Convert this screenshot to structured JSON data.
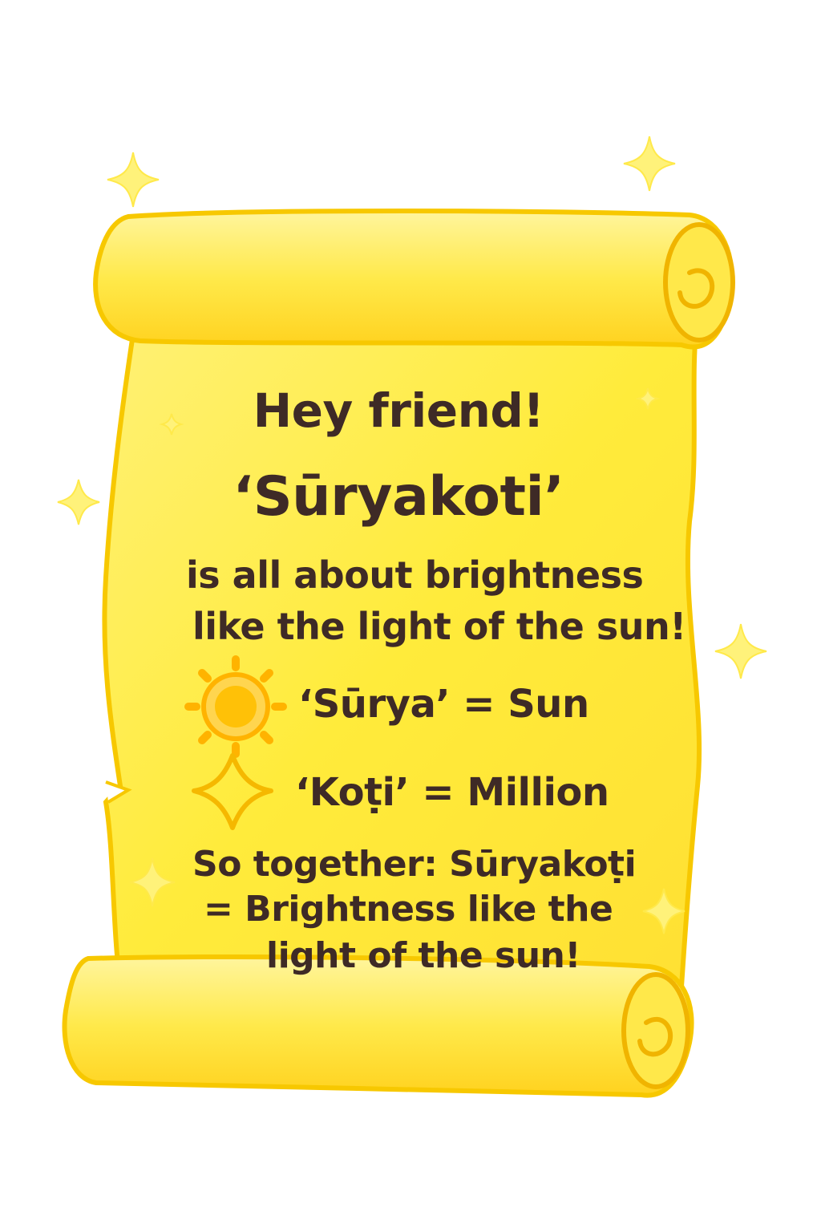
{
  "greeting": "Hey friend!",
  "word": "‘Sūryakoti’",
  "description": {
    "line1": "is all about brightness",
    "line2": "like the light of the sun!"
  },
  "definitions": [
    {
      "icon": "sun-icon",
      "text": "‘Sūrya’ = Sun"
    },
    {
      "icon": "diamond-sparkle-icon",
      "text": "‘Koṭi’ = Million"
    }
  ],
  "summary": {
    "line1": "So together: Sūryakoṭi",
    "line2": "= Brightness like the",
    "line3": "light of the sun!"
  },
  "colors": {
    "parchment": "#ffe84a",
    "parchment_edge": "#f5c400",
    "text": "#3e2a26",
    "sun": "#ffb300",
    "sparkle": "#fff27a"
  }
}
